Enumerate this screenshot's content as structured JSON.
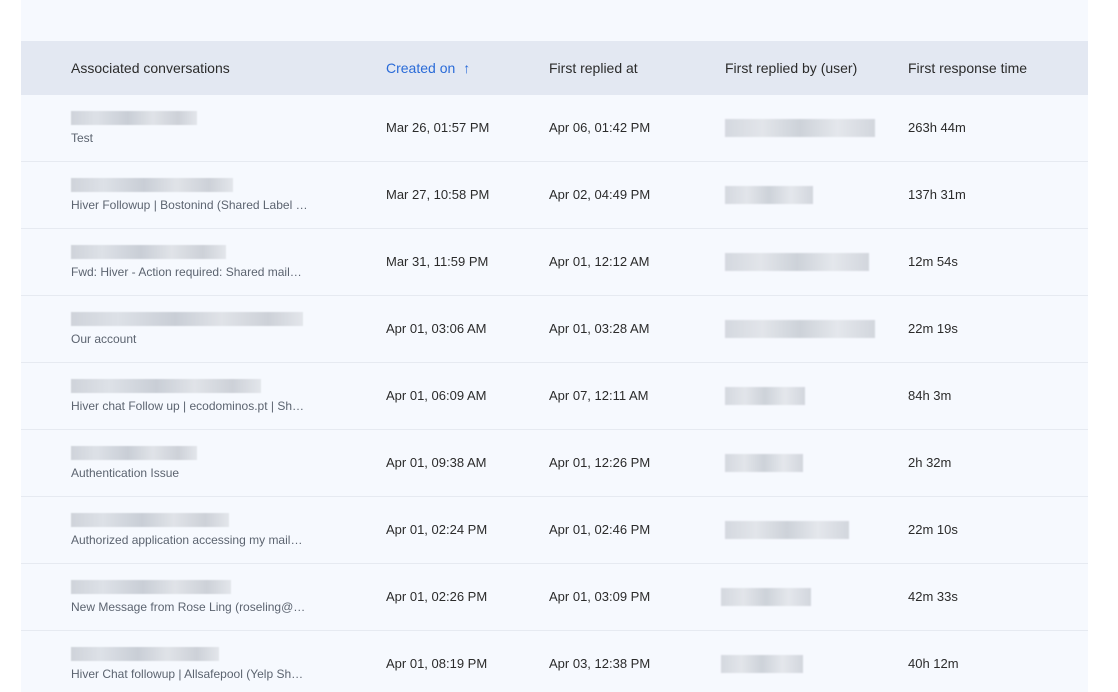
{
  "table": {
    "columns": {
      "conversations": "Associated conversations",
      "created_on": "Created on",
      "first_replied_at": "First replied at",
      "first_replied_by": "First replied by (user)",
      "first_response_time": "First response time"
    },
    "sort_icon": "↑",
    "rows": [
      {
        "subject": "Test",
        "created_on": "Mar 26, 01:57 PM",
        "first_replied_at": "Apr 06, 01:42 PM",
        "first_response_time": "263h 44m"
      },
      {
        "subject": "Hiver Followup | Bostonind (Shared Label …",
        "created_on": "Mar 27, 10:58 PM",
        "first_replied_at": "Apr 02, 04:49 PM",
        "first_response_time": "137h 31m"
      },
      {
        "subject": "Fwd: Hiver - Action required: Shared mail…",
        "created_on": "Mar 31, 11:59 PM",
        "first_replied_at": "Apr 01, 12:12 AM",
        "first_response_time": "12m 54s"
      },
      {
        "subject": "Our account",
        "created_on": "Apr 01, 03:06 AM",
        "first_replied_at": "Apr 01, 03:28 AM",
        "first_response_time": "22m 19s"
      },
      {
        "subject": "Hiver chat Follow up | ecodominos.pt | Sh…",
        "created_on": "Apr 01, 06:09 AM",
        "first_replied_at": "Apr 07, 12:11 AM",
        "first_response_time": "84h 3m"
      },
      {
        "subject": "Authentication Issue",
        "created_on": "Apr 01, 09:38 AM",
        "first_replied_at": "Apr 01, 12:26 PM",
        "first_response_time": "2h 32m"
      },
      {
        "subject": "Authorized application accessing my mail…",
        "created_on": "Apr 01, 02:24 PM",
        "first_replied_at": "Apr 01, 02:46 PM",
        "first_response_time": "22m 10s"
      },
      {
        "subject": "New Message from Rose Ling (roseling@…",
        "created_on": "Apr 01, 02:26 PM",
        "first_replied_at": "Apr 01, 03:09 PM",
        "first_response_time": "42m 33s"
      },
      {
        "subject": "Hiver Chat followup | Allsafepool (Yelp Sh…",
        "created_on": "Apr 01, 08:19 PM",
        "first_replied_at": "Apr 03, 12:38 PM",
        "first_response_time": "40h 12m"
      }
    ]
  },
  "colors": {
    "accent": "#2a6bd8",
    "header_bg": "#e3e8f2",
    "panel_bg": "#f6f9fe"
  }
}
